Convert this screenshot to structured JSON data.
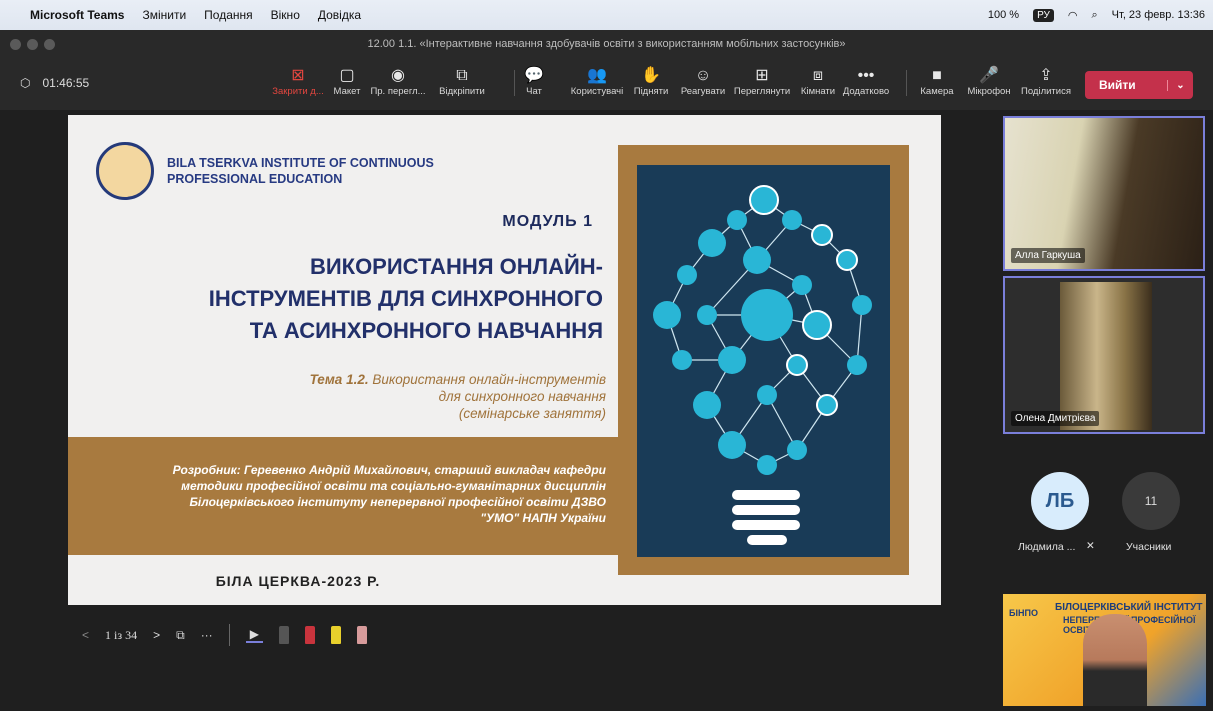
{
  "menubar": {
    "app": "Microsoft Teams",
    "items": [
      "Змінити",
      "Подання",
      "Вікно",
      "Довідка"
    ],
    "battery": "100 %",
    "lang": "РУ",
    "clock": "Чт, 23 февр.  13:36"
  },
  "window": {
    "title": "12.00 1.1. «Інтерактивне навчання здобувачів освіти з використанням мобільних застосунків»"
  },
  "toolbar": {
    "timer": "01:46:55",
    "buttons": [
      {
        "label": "Закрити д...",
        "icon": "close-share-icon",
        "glyph": "⊠"
      },
      {
        "label": "Макет",
        "icon": "layout-icon",
        "glyph": "▢"
      },
      {
        "label": "Пр. перегл...",
        "icon": "view-icon",
        "glyph": "◉"
      },
      {
        "label": "Відкріпити",
        "icon": "popout-icon",
        "glyph": "⧉"
      },
      {
        "label": "Чат",
        "icon": "chat-icon",
        "glyph": "💬"
      },
      {
        "label": "Користувачі",
        "icon": "people-icon",
        "glyph": "👥"
      },
      {
        "label": "Підняти",
        "icon": "raise-hand-icon",
        "glyph": "✋"
      },
      {
        "label": "Реагувати",
        "icon": "react-icon",
        "glyph": "☺"
      },
      {
        "label": "Переглянути",
        "icon": "view-grid-icon",
        "glyph": "⊞"
      },
      {
        "label": "Кімнати",
        "icon": "rooms-icon",
        "glyph": "⧈"
      },
      {
        "label": "Додатково",
        "icon": "more-icon",
        "glyph": "•••"
      },
      {
        "label": "Камера",
        "icon": "camera-icon",
        "glyph": "■"
      },
      {
        "label": "Мікрофон",
        "icon": "mic-icon",
        "glyph": "🎤"
      },
      {
        "label": "Поділитися",
        "icon": "share-icon",
        "glyph": "⇪"
      }
    ],
    "leave": "Вийти"
  },
  "slide": {
    "institute": [
      "BILA TSERKVA INSTITUTE OF CONTINUOUS",
      "PROFESSIONAL EDUCATION"
    ],
    "module": "МОДУЛЬ 1",
    "title": [
      "ВИКОРИСТАННЯ ОНЛАЙН-",
      "ІНСТРУМЕНТІВ ДЛЯ СИНХРОННОГО",
      "ТА АСИНХРОННОГО НАВЧАННЯ"
    ],
    "topic_label": "Тема 1.2.",
    "topic": [
      "Використання онлайн-інструментів",
      "для синхронного навчання",
      "(семінарське заняття)"
    ],
    "author": [
      "Розробник: Геревенко Андрій Михайлович, старший викладач кафедри",
      "методики професійної освіти та соціально-гуманітарних дисциплін",
      "Білоцерківського інституту неперервної професійної освіти ДЗВО",
      "\"УМО\" НАПН України"
    ],
    "city": "БІЛА ЦЕРКВА-2023 Р."
  },
  "participants": {
    "tile1": "Алла Гаркуша",
    "tile2": "Олена Дмитрієва",
    "avatar_initials": "ЛБ",
    "avatar_name": "Людмила ...",
    "count": "11",
    "count_label": "Учасники"
  },
  "selfview": {
    "title": "БІЛОЦЕРКІВСЬКИЙ ІНСТИТУТ",
    "subtitle": "НЕПЕРЕРВНОЇ ПРОФЕСІЙНОЇ ОСВІТИ",
    "logo": "БІНПО"
  },
  "pager": {
    "page": "1 із 34"
  },
  "colors": {
    "accent_blue": "#22306a",
    "gold": "#a87a3f",
    "leave_red": "#c4314b",
    "teal": "#29b6d6"
  }
}
